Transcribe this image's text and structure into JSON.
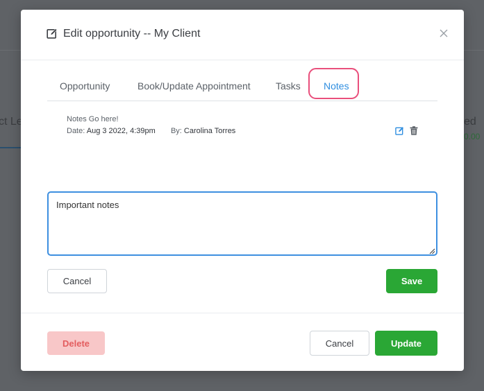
{
  "background": {
    "left_text": "ct Le",
    "right_text": "ed",
    "right_subtext": "0.00"
  },
  "modal": {
    "title": "Edit opportunity -- My Client",
    "tabs": [
      {
        "label": "Opportunity",
        "active": false
      },
      {
        "label": "Book/Update Appointment",
        "active": false
      },
      {
        "label": "Tasks",
        "active": false
      },
      {
        "label": "Notes",
        "active": true
      }
    ],
    "note": {
      "text": "Notes Go here!",
      "date_label": "Date:",
      "date_value": "Aug 3 2022, 4:39pm",
      "by_label": "By:",
      "by_value": "Carolina Torres"
    },
    "editor": {
      "value": "Important notes"
    },
    "buttons": {
      "cancel_note": "Cancel",
      "save": "Save",
      "delete": "Delete",
      "cancel": "Cancel",
      "update": "Update"
    }
  },
  "colors": {
    "accent": "#2f8ee0",
    "success": "#2aa735",
    "danger_bg": "#f8c7c8",
    "danger_text": "#e35d5f",
    "highlight": "#e94f7c"
  }
}
